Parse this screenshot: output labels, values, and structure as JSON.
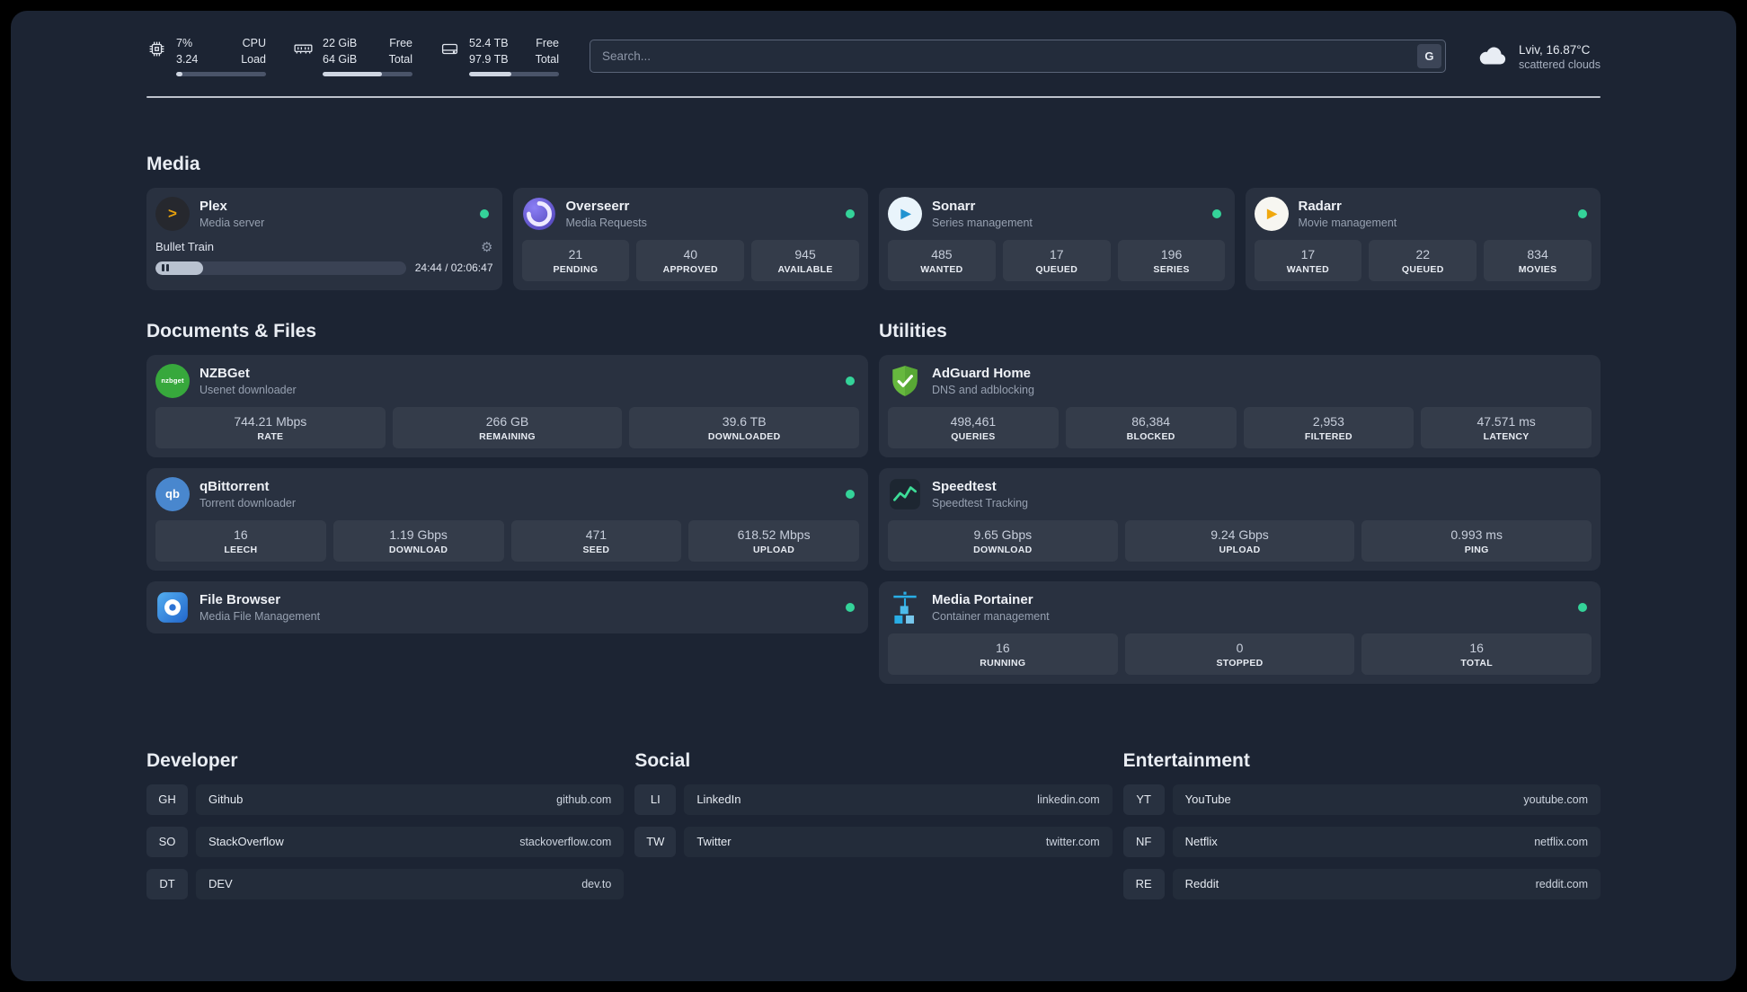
{
  "colors": {
    "status_online": "#34d399"
  },
  "header": {
    "resources": [
      {
        "icon": "cpu-icon",
        "top_left": "7%",
        "top_right": "CPU",
        "bottom_left": "3.24",
        "bottom_right": "Load",
        "progress": 7
      },
      {
        "icon": "memory-icon",
        "top_left": "22 GiB",
        "top_right": "Free",
        "bottom_left": "64 GiB",
        "bottom_right": "Total",
        "progress": 66
      },
      {
        "icon": "disk-icon",
        "top_left": "52.4 TB",
        "top_right": "Free",
        "bottom_left": "97.9 TB",
        "bottom_right": "Total",
        "progress": 47
      }
    ],
    "search": {
      "placeholder": "Search...",
      "provider": "G"
    },
    "weather": {
      "location": "Lviv, 16.87°C",
      "condition": "scattered clouds"
    }
  },
  "sections": {
    "media": "Media",
    "documents": "Documents & Files",
    "utilities": "Utilities",
    "developer": "Developer",
    "social": "Social",
    "entertainment": "Entertainment"
  },
  "icons": {
    "plex": ">",
    "play": "▶",
    "qb": "qb",
    "nzb": "nzbget",
    "gear": "⚙"
  },
  "apps": {
    "plex": {
      "name": "Plex",
      "desc": "Media server",
      "player": {
        "title": "Bullet Train",
        "time": "24:44 / 02:06:47",
        "progress": 19
      }
    },
    "overseerr": {
      "name": "Overseerr",
      "desc": "Media Requests",
      "stats": [
        {
          "value": "21",
          "label": "PENDING"
        },
        {
          "value": "40",
          "label": "APPROVED"
        },
        {
          "value": "945",
          "label": "AVAILABLE"
        }
      ]
    },
    "sonarr": {
      "name": "Sonarr",
      "desc": "Series management",
      "stats": [
        {
          "value": "485",
          "label": "WANTED"
        },
        {
          "value": "17",
          "label": "QUEUED"
        },
        {
          "value": "196",
          "label": "SERIES"
        }
      ]
    },
    "radarr": {
      "name": "Radarr",
      "desc": "Movie management",
      "stats": [
        {
          "value": "17",
          "label": "WANTED"
        },
        {
          "value": "22",
          "label": "QUEUED"
        },
        {
          "value": "834",
          "label": "MOVIES"
        }
      ]
    },
    "nzbget": {
      "name": "NZBGet",
      "desc": "Usenet downloader",
      "stats": [
        {
          "value": "744.21 Mbps",
          "label": "RATE"
        },
        {
          "value": "266 GB",
          "label": "REMAINING"
        },
        {
          "value": "39.6 TB",
          "label": "DOWNLOADED"
        }
      ]
    },
    "qbittorrent": {
      "name": "qBittorrent",
      "desc": "Torrent downloader",
      "stats": [
        {
          "value": "16",
          "label": "LEECH"
        },
        {
          "value": "1.19 Gbps",
          "label": "DOWNLOAD"
        },
        {
          "value": "471",
          "label": "SEED"
        },
        {
          "value": "618.52 Mbps",
          "label": "UPLOAD"
        }
      ]
    },
    "filebrowser": {
      "name": "File Browser",
      "desc": "Media File Management"
    },
    "adguard": {
      "name": "AdGuard Home",
      "desc": "DNS and adblocking",
      "stats": [
        {
          "value": "498,461",
          "label": "QUERIES"
        },
        {
          "value": "86,384",
          "label": "BLOCKED"
        },
        {
          "value": "2,953",
          "label": "FILTERED"
        },
        {
          "value": "47.571 ms",
          "label": "LATENCY"
        }
      ]
    },
    "speedtest": {
      "name": "Speedtest",
      "desc": "Speedtest Tracking",
      "stats": [
        {
          "value": "9.65 Gbps",
          "label": "DOWNLOAD"
        },
        {
          "value": "9.24 Gbps",
          "label": "UPLOAD"
        },
        {
          "value": "0.993 ms",
          "label": "PING"
        }
      ]
    },
    "portainer": {
      "name": "Media Portainer",
      "desc": "Container management",
      "stats": [
        {
          "value": "16",
          "label": "RUNNING"
        },
        {
          "value": "0",
          "label": "STOPPED"
        },
        {
          "value": "16",
          "label": "TOTAL"
        }
      ]
    }
  },
  "bookmarks": {
    "developer": [
      {
        "abbr": "GH",
        "name": "Github",
        "url": "github.com"
      },
      {
        "abbr": "SO",
        "name": "StackOverflow",
        "url": "stackoverflow.com"
      },
      {
        "abbr": "DT",
        "name": "DEV",
        "url": "dev.to"
      }
    ],
    "social": [
      {
        "abbr": "LI",
        "name": "LinkedIn",
        "url": "linkedin.com"
      },
      {
        "abbr": "TW",
        "name": "Twitter",
        "url": "twitter.com"
      }
    ],
    "entertainment": [
      {
        "abbr": "YT",
        "name": "YouTube",
        "url": "youtube.com"
      },
      {
        "abbr": "NF",
        "name": "Netflix",
        "url": "netflix.com"
      },
      {
        "abbr": "RE",
        "name": "Reddit",
        "url": "reddit.com"
      }
    ]
  }
}
